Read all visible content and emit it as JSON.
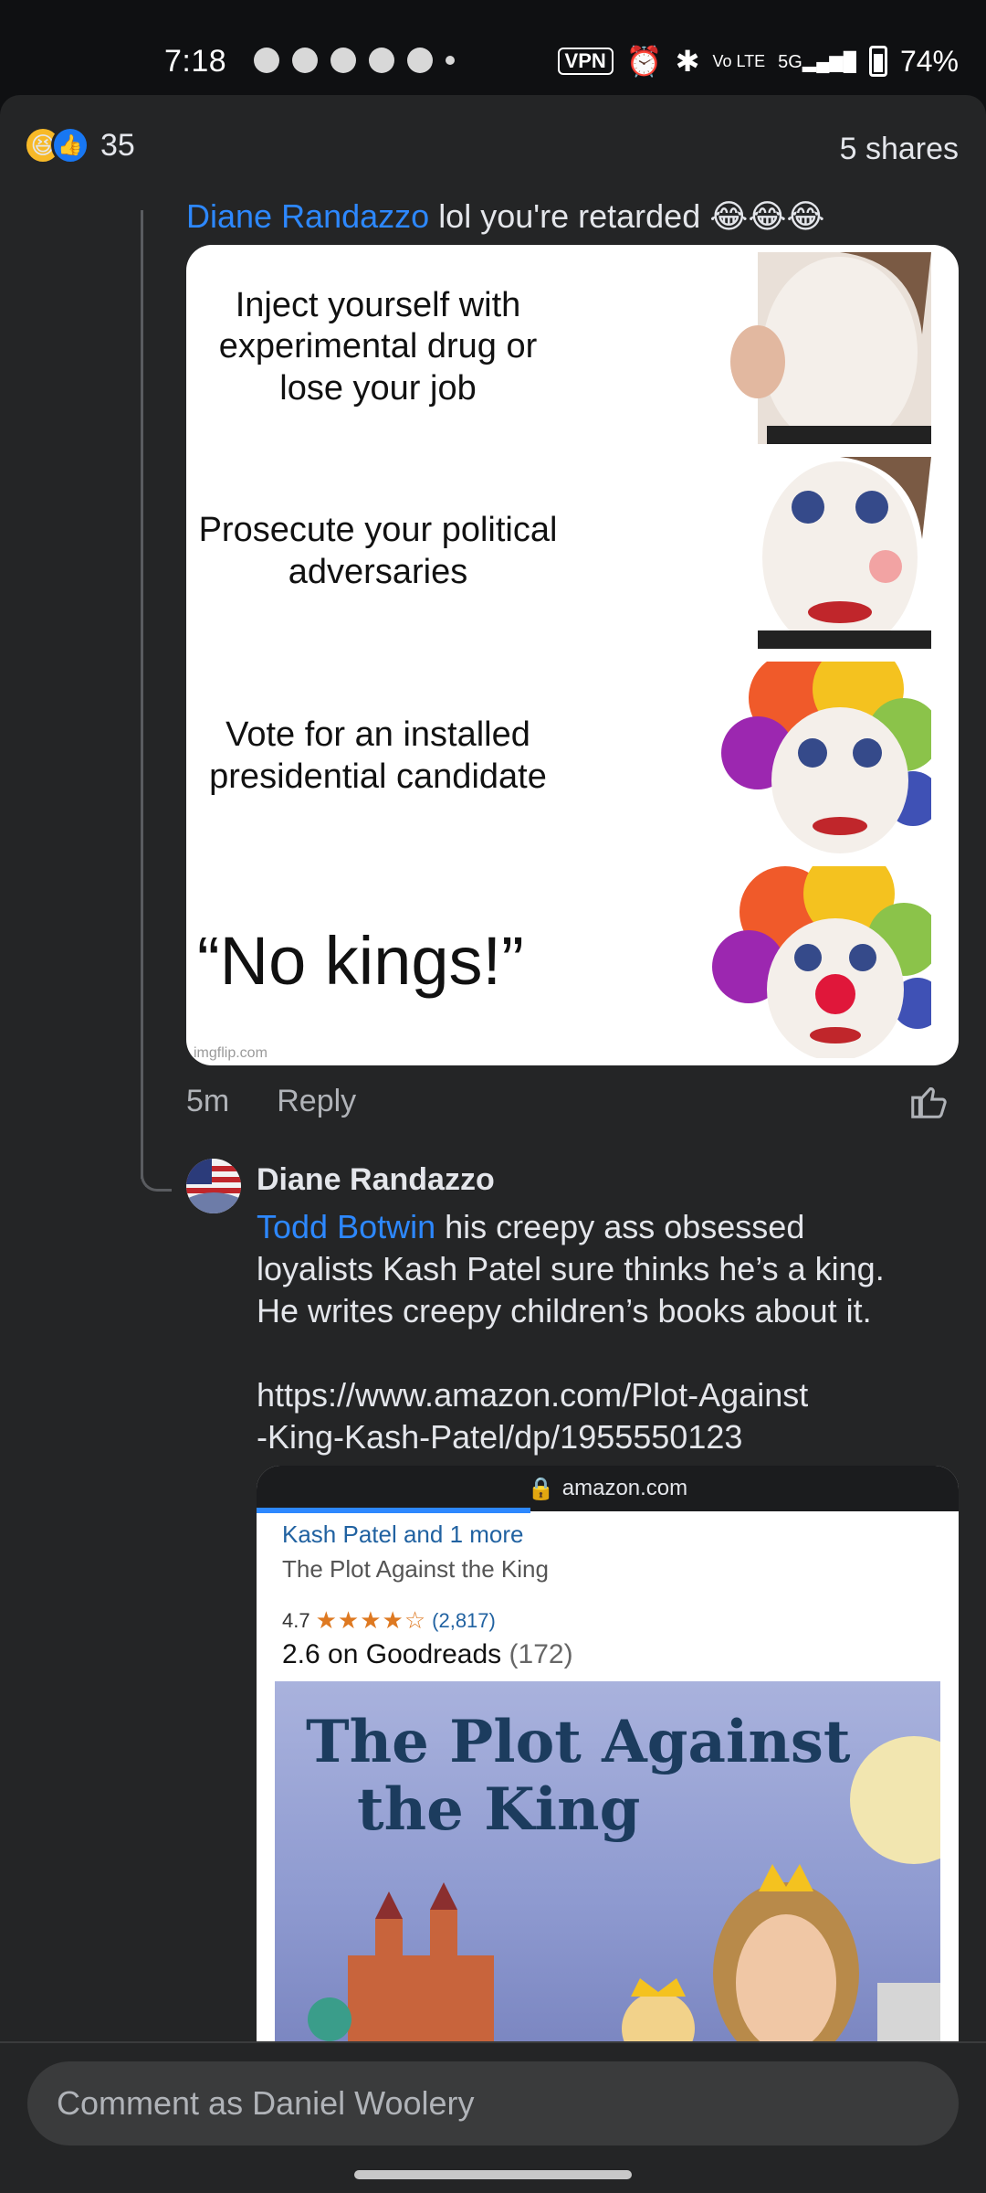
{
  "status_bar": {
    "time": "7:18",
    "vpn_label": "VPN",
    "network_label": "5G",
    "battery": "74%",
    "icons": [
      "chat-icon",
      "snapchat-icon",
      "messenger-icon",
      "messenger-icon",
      "messenger-icon",
      "dot-icon",
      "vpn-icon",
      "alarm-icon",
      "bluetooth-icon",
      "volte-icon",
      "signal-icon",
      "battery-icon"
    ]
  },
  "post_summary": {
    "reaction_count": "35",
    "reactions": [
      "haha",
      "like"
    ],
    "shares": "5 shares"
  },
  "comment1": {
    "mention": "Diane Randazzo",
    "text": "lol you're retarded",
    "emojis": "😂😂😂",
    "meme_captions": [
      "Inject yourself with experimental drug or lose your job",
      "Prosecute your political adversaries",
      "Vote for an installed presidential candidate",
      "“No kings!”"
    ],
    "meme_watermark": "imgflip.com",
    "time": "5m",
    "reply_label": "Reply"
  },
  "comment2": {
    "author": "Diane Randazzo",
    "mention": "Todd Botwin",
    "text_line1": " his creepy ass obsessed",
    "text_line2": "loyalists Kash Patel sure thinks he’s a king.",
    "text_line3": "He writes creepy children’s books about it.",
    "url_line1": "https://www.amazon.com/Plot-Against",
    "url_line2": "-King-Kash-Patel/dp/1955550123"
  },
  "link_preview": {
    "domain": "amazon.com",
    "author_line": "Kash Patel and 1 more",
    "title": "The Plot Against the King",
    "rating": "4.7",
    "stars": "★★★★☆",
    "rating_count": "(2,817)",
    "goodreads_label": "2.6 on Goodreads",
    "goodreads_count": "(172)",
    "cover_title_line1": "The Plot Against",
    "cover_title_line2": "the King"
  },
  "composer": {
    "placeholder": "Comment as Daniel Woolery"
  },
  "colors": {
    "background": "#242526",
    "link": "#2d88ff",
    "muted": "#b0b3b8"
  }
}
